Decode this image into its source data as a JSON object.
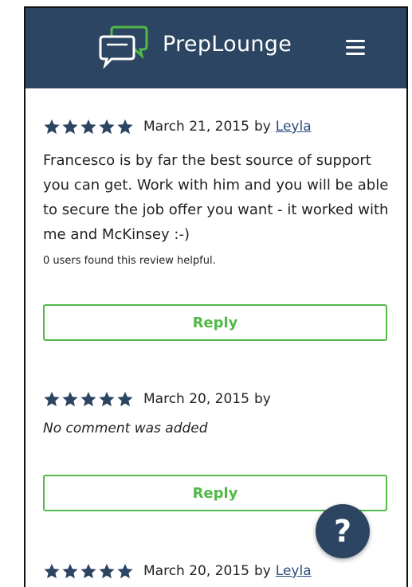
{
  "header": {
    "brand": "PrepLounge",
    "background": "#2c4562"
  },
  "reviews": [
    {
      "rating": 5,
      "date": "March 21, 2015",
      "by_label": "by",
      "author": "Leyla",
      "text": "Francesco is by far the best source of support you can get. Work with him and you will be able to secure the job offer you want - it worked with me and McKinsey :-)",
      "helpful": "0 users found this review helpful.",
      "reply_label": "Reply"
    },
    {
      "rating": 5,
      "date": "March 20, 2015",
      "by_label": "by",
      "author": "",
      "no_comment": "No comment was added",
      "reply_label": "Reply"
    },
    {
      "rating": 5,
      "date": "March 20, 2015",
      "by_label": "by",
      "author": "Leyla"
    }
  ],
  "help_button": {
    "label": "?"
  },
  "colors": {
    "accent_green": "#52b848",
    "star_navy": "#2c4562",
    "link": "#2a4b7c"
  }
}
